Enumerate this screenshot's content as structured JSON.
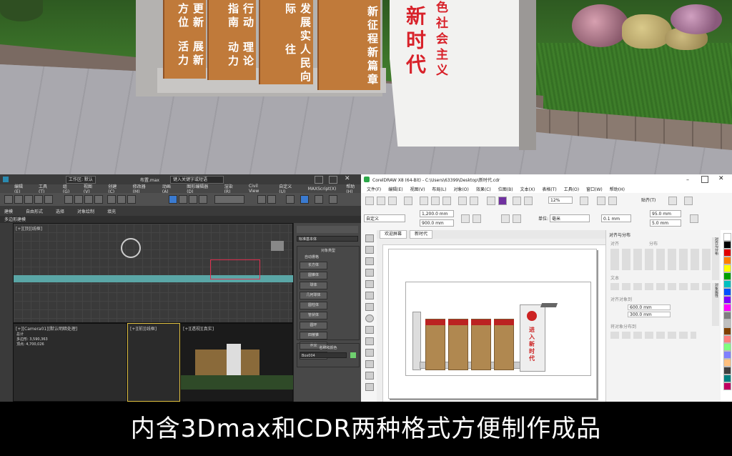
{
  "render": {
    "planks": [
      {
        "text": "更新方位"
      },
      {
        "text": "展新活力"
      },
      {
        "text": "行动指南"
      },
      {
        "text": "理论动力"
      },
      {
        "text": "发展实际"
      },
      {
        "text": "人民向往"
      },
      {
        "text": "新征程"
      },
      {
        "text": "新篇章"
      }
    ],
    "slogan_big": "新时代",
    "slogan_small": "色社会主义",
    "colors": {
      "plank": "#c07a3a",
      "slogan": "#d8222a",
      "grass": "#3f7a2c"
    }
  },
  "max": {
    "title_file": "布置.max",
    "title_search": "键入关键字或短语",
    "workspace": "工作区: 默认",
    "menu": [
      "编辑(E)",
      "工具(T)",
      "组(G)",
      "视图(V)",
      "创建(C)",
      "修改器(M)",
      "动画(A)",
      "图形编辑器(D)",
      "渲染(R)",
      "Civil View",
      "自定义(U)",
      "MAXScript(X)",
      "帮助(H)"
    ],
    "ribbon": [
      "建模",
      "自由形式",
      "选择",
      "对象绘制",
      "填充"
    ],
    "sub_label": "多边形建模",
    "viewports": [
      "[+][顶][线框]",
      "[+][前][线框]",
      "[+][Camera01][默认明暗处理]",
      "[+][透视][真实]"
    ],
    "stats": [
      "总计",
      "多边形: 3,590,363",
      "顶点: 4,700,026"
    ],
    "command_panel": {
      "dropdown": "标准基本体",
      "section": "对象类型",
      "autogrid": "自动栅格",
      "buttons": [
        "长方体",
        "圆锥体",
        "球体",
        "几何球体",
        "圆柱体",
        "管状体",
        "圆环",
        "四棱锥",
        "茶壶",
        "平面"
      ],
      "name_section": "名称和颜色",
      "name_value": "Box004"
    }
  },
  "cdr": {
    "title": "CorelDRAW X8 (64-Bit) - C:\\Users\\63399\\Desktop\\新时代.cdr",
    "menu": [
      "文件(F)",
      "编辑(E)",
      "视图(V)",
      "布局(L)",
      "对象(O)",
      "效果(C)",
      "位图(B)",
      "文本(X)",
      "表格(T)",
      "工具(O)",
      "窗口(W)",
      "帮助(H)"
    ],
    "zoom": "12%",
    "snap": "贴齐(T)",
    "preset": "自定义",
    "width": "1,200.0 mm",
    "height": "900.0 mm",
    "units_label": "单位:",
    "units_value": "毫米",
    "nudge": "0.1 mm",
    "dup_x": "95.0 mm",
    "dup_y": "5.0 mm",
    "tabs": [
      "欢迎屏幕",
      "新时代"
    ],
    "docker_title": "对齐与分布",
    "docker_sections": [
      "对齐",
      "分布",
      "文本",
      "对齐对象到",
      "将对象分布到"
    ],
    "docker_x": "600.0 mm",
    "docker_y": "300.0 mm",
    "right_tabs": [
      "对齐与分布",
      "对象属性"
    ],
    "mini_slogan": "进入新时代",
    "palette": [
      "#ffffff",
      "#000000",
      "#e00000",
      "#ff7f00",
      "#ffff00",
      "#00a000",
      "#00c0c0",
      "#0050ff",
      "#8000ff",
      "#ff00ff",
      "#7f7f7f",
      "#c0c0c0",
      "#804000",
      "#ff8080",
      "#80ff80",
      "#8080ff",
      "#ffc080",
      "#404040",
      "#008080",
      "#c00060"
    ]
  },
  "caption": "内含3Dmax和CDR两种格式方便制作成品"
}
